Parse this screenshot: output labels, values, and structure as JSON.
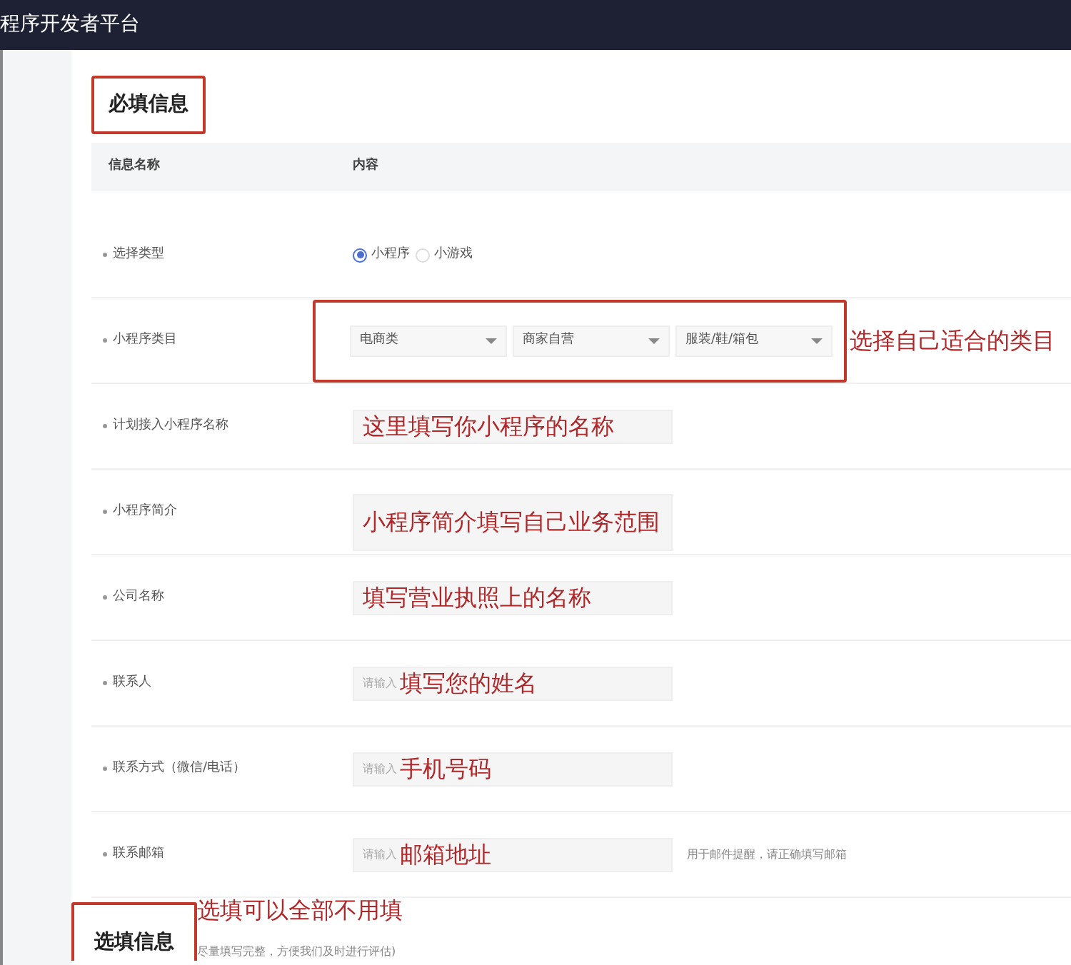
{
  "topbar": {
    "title": "程序开发者平台"
  },
  "required_section": {
    "title": "必填信息",
    "columns": [
      "信息名称",
      "内容"
    ],
    "rows": [
      {
        "kind": "radio",
        "label": "选择类型",
        "options": [
          {
            "label": "小程序",
            "selected": true
          },
          {
            "label": "小游戏",
            "selected": false
          }
        ]
      },
      {
        "kind": "selects",
        "label": "小程序类目",
        "selects": [
          "电商类",
          "商家自营",
          "服装/鞋/箱包"
        ],
        "annotation": "选择自己适合的类目"
      },
      {
        "kind": "input",
        "label": "计划接入小程序名称",
        "annotation": "这里填写你小程序的名称"
      },
      {
        "kind": "textarea",
        "label": "小程序简介",
        "annotation": "小程序简介填写自己业务范围"
      },
      {
        "kind": "input",
        "label": "公司名称",
        "annotation": "填写营业执照上的名称"
      },
      {
        "kind": "input",
        "label": "联系人",
        "placeholder": "请输入",
        "annotation": "填写您的姓名"
      },
      {
        "kind": "input",
        "label": "联系方式（微信/电话）",
        "placeholder": "请输入",
        "annotation": "手机号码"
      },
      {
        "kind": "input",
        "label": "联系邮箱",
        "placeholder": "请输入",
        "annotation": "邮箱地址",
        "hint": "用于邮件提醒，请正确填写邮箱"
      }
    ]
  },
  "optional_section": {
    "title": "选填信息",
    "note": "尽量填写完整，方便我们及时进行评估)",
    "annotation": "选填可以全部不用填"
  }
}
